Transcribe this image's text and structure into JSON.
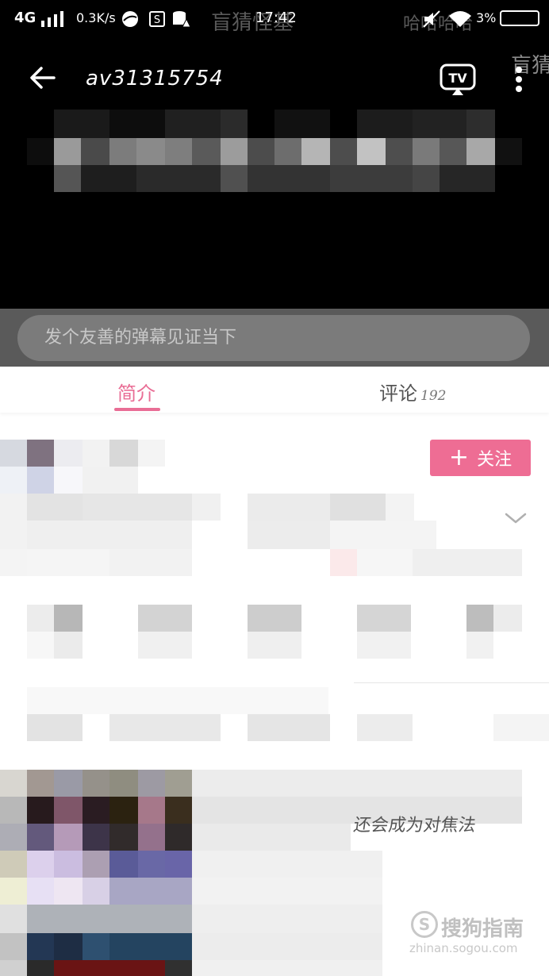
{
  "status_bar": {
    "network": "4G",
    "speed": "0.3K/s",
    "time": "17:42",
    "battery": "3%",
    "watermark_left": "盲猜怪基",
    "watermark_right": "哈哈哈哈"
  },
  "player": {
    "video_id": "av31315754",
    "watermark": "盲猜"
  },
  "danmaku": {
    "placeholder": "发个友善的弹幕见证当下"
  },
  "tabs": {
    "intro_label": "简介",
    "comments_label": "评论",
    "comments_count": "192"
  },
  "uploader": {
    "follow_label": "关注"
  },
  "description": {
    "visible_text": "还会成为对焦法"
  },
  "watermark": {
    "brand": "搜狗指南",
    "url": "zhinan.sogou.com"
  },
  "colors": {
    "accent": "#ee6d94",
    "tab_active": "#e96d95",
    "player_bg": "#000000",
    "danmaku_bar": "#5a5a5a"
  }
}
